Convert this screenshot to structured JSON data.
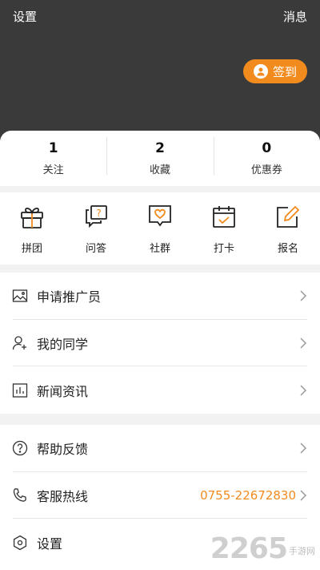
{
  "header": {
    "settings_label": "设置",
    "messages_label": "消息",
    "signin_label": "签到"
  },
  "stats": [
    {
      "value": "1",
      "label": "关注"
    },
    {
      "value": "2",
      "label": "收藏"
    },
    {
      "value": "0",
      "label": "优惠券"
    }
  ],
  "features": [
    {
      "label": "拼团",
      "icon": "gift-icon"
    },
    {
      "label": "问答",
      "icon": "qa-icon"
    },
    {
      "label": "社群",
      "icon": "heart-chat-icon"
    },
    {
      "label": "打卡",
      "icon": "calendar-check-icon"
    },
    {
      "label": "报名",
      "icon": "edit-icon"
    }
  ],
  "menu_a": [
    {
      "label": "申请推广员",
      "icon": "image-icon"
    },
    {
      "label": "我的同学",
      "icon": "add-user-icon"
    },
    {
      "label": "新闻资讯",
      "icon": "chart-icon"
    }
  ],
  "menu_b": [
    {
      "label": "帮助反馈",
      "icon": "help-icon"
    },
    {
      "label": "客服热线",
      "icon": "phone-icon",
      "value": "0755-22672830"
    },
    {
      "label": "设置",
      "icon": "hexagon-settings-icon"
    }
  ],
  "watermark": {
    "main": "2265",
    "sub": "手游网"
  },
  "colors": {
    "accent": "#f28b1e",
    "header_bg": "#3a3a3a",
    "page_bg": "#f2f2f2"
  }
}
